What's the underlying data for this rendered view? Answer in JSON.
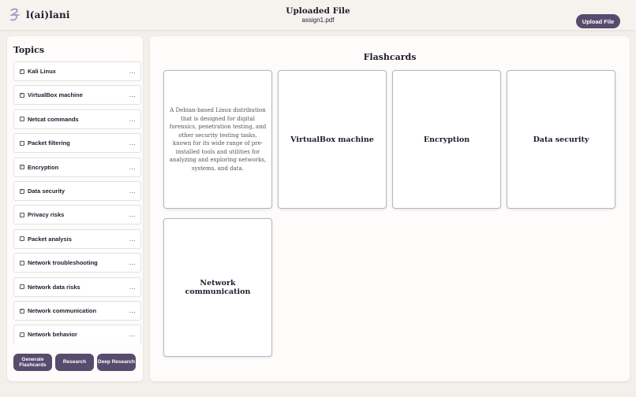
{
  "header": {
    "logo_text": "l(ai)lani",
    "title": "Uploaded File",
    "filename": "assign1.pdf",
    "upload_label": "Upload File"
  },
  "sidebar": {
    "title": "Topics",
    "topics": [
      {
        "label": "Kali Linux",
        "checked": true
      },
      {
        "label": "VirtualBox machine",
        "checked": true
      },
      {
        "label": "Netcat commands",
        "checked": false
      },
      {
        "label": "Packet filtering",
        "checked": false
      },
      {
        "label": "Encryption",
        "checked": true
      },
      {
        "label": "Data security",
        "checked": true
      },
      {
        "label": "Privacy risks",
        "checked": false
      },
      {
        "label": "Packet analysis",
        "checked": false
      },
      {
        "label": "Network troubleshooting",
        "checked": false
      },
      {
        "label": "Network data risks",
        "checked": false
      },
      {
        "label": "Network communication",
        "checked": true
      },
      {
        "label": "Network behavior",
        "checked": false
      }
    ],
    "more_label": "...",
    "buttons": {
      "generate": "Generate Flashcards",
      "research": "Research",
      "deep_research": "Deep Research"
    }
  },
  "main": {
    "title": "Flashcards",
    "cards": [
      {
        "text": "A Debian-based Linux distribution that is designed for digital forensics, penetration testing, and other security testing tasks, known for its wide range of pre-installed tools and utilities for analyzing and exploring networks, systems, and data.",
        "flipped": true
      },
      {
        "text": "VirtualBox machine",
        "flipped": false
      },
      {
        "text": "Encryption",
        "flipped": false
      },
      {
        "text": "Data security",
        "flipped": false
      },
      {
        "text": "Network communication",
        "flipped": false
      }
    ]
  },
  "colors": {
    "accent": "#574b6e",
    "background": "#f3f0ec",
    "card_border": "#b8b2c9",
    "logo": "#9d8fc4"
  }
}
